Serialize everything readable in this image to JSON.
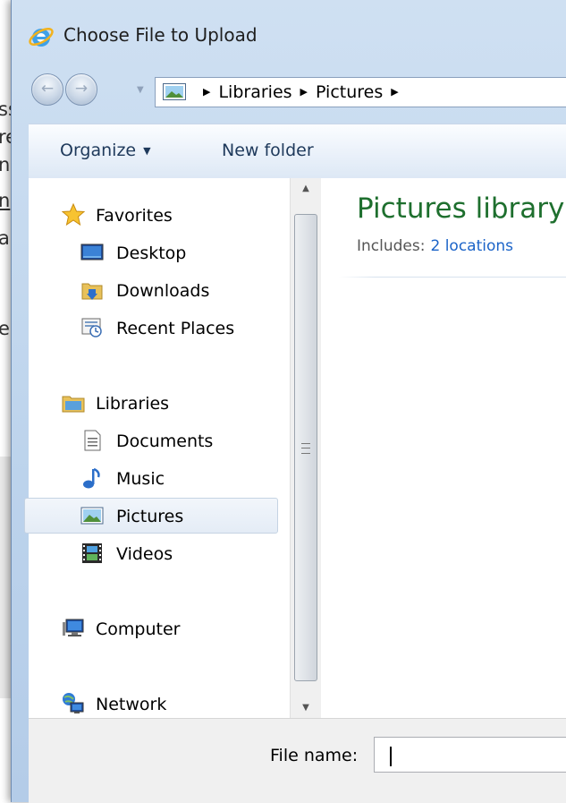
{
  "background_page": {
    "fragments": [
      "ss",
      "re",
      "nc",
      "n",
      "a",
      "e"
    ]
  },
  "dialog": {
    "title": "Choose File to Upload",
    "icon": "internet-explorer-icon"
  },
  "navigation": {
    "back_icon": "back-arrow-icon",
    "forward_icon": "forward-arrow-icon",
    "breadcrumbs": [
      "Libraries",
      "Pictures"
    ]
  },
  "toolbar": {
    "organize_label": "Organize",
    "new_folder_label": "New folder"
  },
  "nav_pane": {
    "favorites": {
      "label": "Favorites",
      "icon": "star-icon"
    },
    "favorites_items": [
      {
        "label": "Desktop",
        "icon": "desktop-icon"
      },
      {
        "label": "Downloads",
        "icon": "downloads-folder-icon"
      },
      {
        "label": "Recent Places",
        "icon": "recent-places-icon"
      }
    ],
    "libraries": {
      "label": "Libraries",
      "icon": "libraries-folder-icon"
    },
    "libraries_items": [
      {
        "label": "Documents",
        "icon": "document-icon"
      },
      {
        "label": "Music",
        "icon": "music-note-icon"
      },
      {
        "label": "Pictures",
        "icon": "pictures-icon",
        "selected": true
      },
      {
        "label": "Videos",
        "icon": "film-strip-icon"
      }
    ],
    "computer": {
      "label": "Computer",
      "icon": "computer-icon"
    },
    "network": {
      "label": "Network",
      "icon": "network-icon"
    }
  },
  "content": {
    "library_title": "Pictures library",
    "includes_label": "Includes:",
    "includes_link": "2 locations"
  },
  "footer": {
    "file_name_label": "File name:",
    "file_name_value": ""
  },
  "colors": {
    "library_title": "#1e6f2e",
    "link": "#1c64c8",
    "toolbar_text": "#1e395b"
  }
}
